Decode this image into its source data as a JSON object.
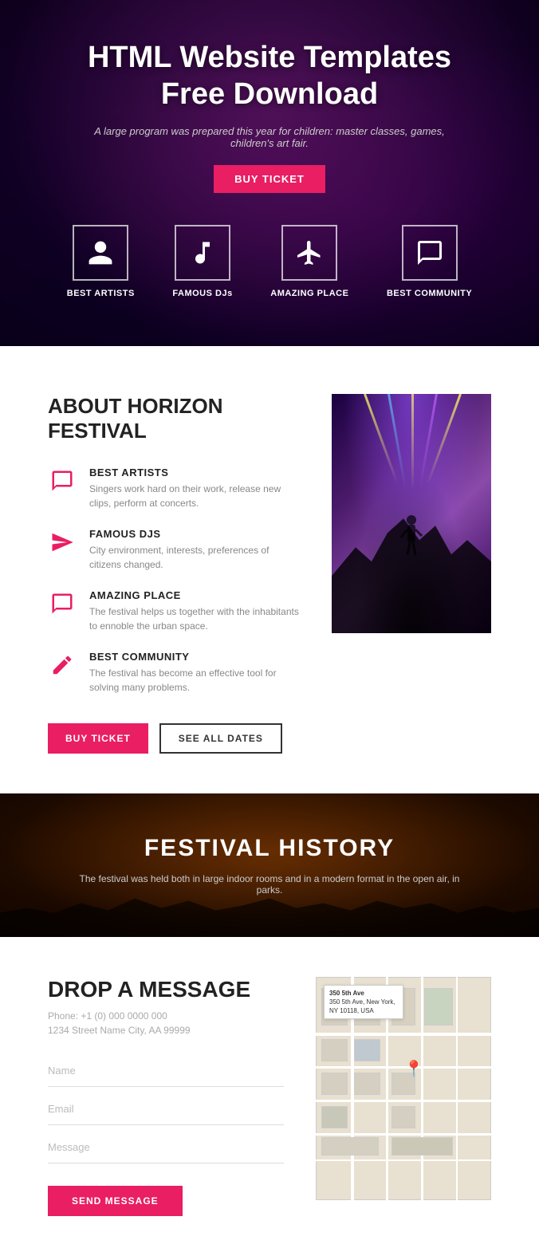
{
  "hero": {
    "title": "HTML Website Templates\nFree Download",
    "subtitle": "A large program was prepared this year for children: master classes, games, children's art fair.",
    "buy_ticket_label": "BUY TICKET"
  },
  "features": [
    {
      "id": "best-artists",
      "label": "BEST ARTISTS",
      "icon": "person"
    },
    {
      "id": "famous-djs",
      "label": "FAMOUS DJs",
      "icon": "music"
    },
    {
      "id": "amazing-place",
      "label": "AMAZING PLACE",
      "icon": "plane"
    },
    {
      "id": "best-community",
      "label": "BEST COMMUNITY",
      "icon": "chat"
    }
  ],
  "about": {
    "title": "ABOUT HORIZON\nFESTIVAL",
    "items": [
      {
        "id": "best-artists",
        "title": "BEST ARTISTS",
        "description": "Singers work hard on their work, release new clips, perform at concerts.",
        "icon": "speech-bubble"
      },
      {
        "id": "famous-djs",
        "title": "FAMOUS DJs",
        "description": "City environment, interests, preferences of citizens changed.",
        "icon": "paper-plane"
      },
      {
        "id": "amazing-place",
        "title": "AMAZING PLACE",
        "description": "The festival helps us together with the inhabitants to ennoble the urban space.",
        "icon": "speech-bubble-2"
      },
      {
        "id": "best-community",
        "title": "BEST COMMUNITY",
        "description": "The festival has become an effective tool for solving many problems.",
        "icon": "edit"
      }
    ],
    "buy_ticket_label": "BUY TICKET",
    "see_all_dates_label": "SEE ALL DATES"
  },
  "history": {
    "title": "FESTIVAL HISTORY",
    "description": "The festival was held both in large indoor rooms and in a modern format in the open air, in parks."
  },
  "contact": {
    "title": "DROP A MESSAGE",
    "phone": "Phone: +1 (0) 000 0000 000",
    "address": "1234 Street Name City, AA 99999",
    "fields": {
      "name_placeholder": "Name",
      "email_placeholder": "Email",
      "message_placeholder": "Message"
    },
    "submit_label": "SEND MESSAGE",
    "map": {
      "address_label": "350 5th Ave",
      "address_full": "350 5th Ave, New York, NY 10118, USA"
    }
  }
}
